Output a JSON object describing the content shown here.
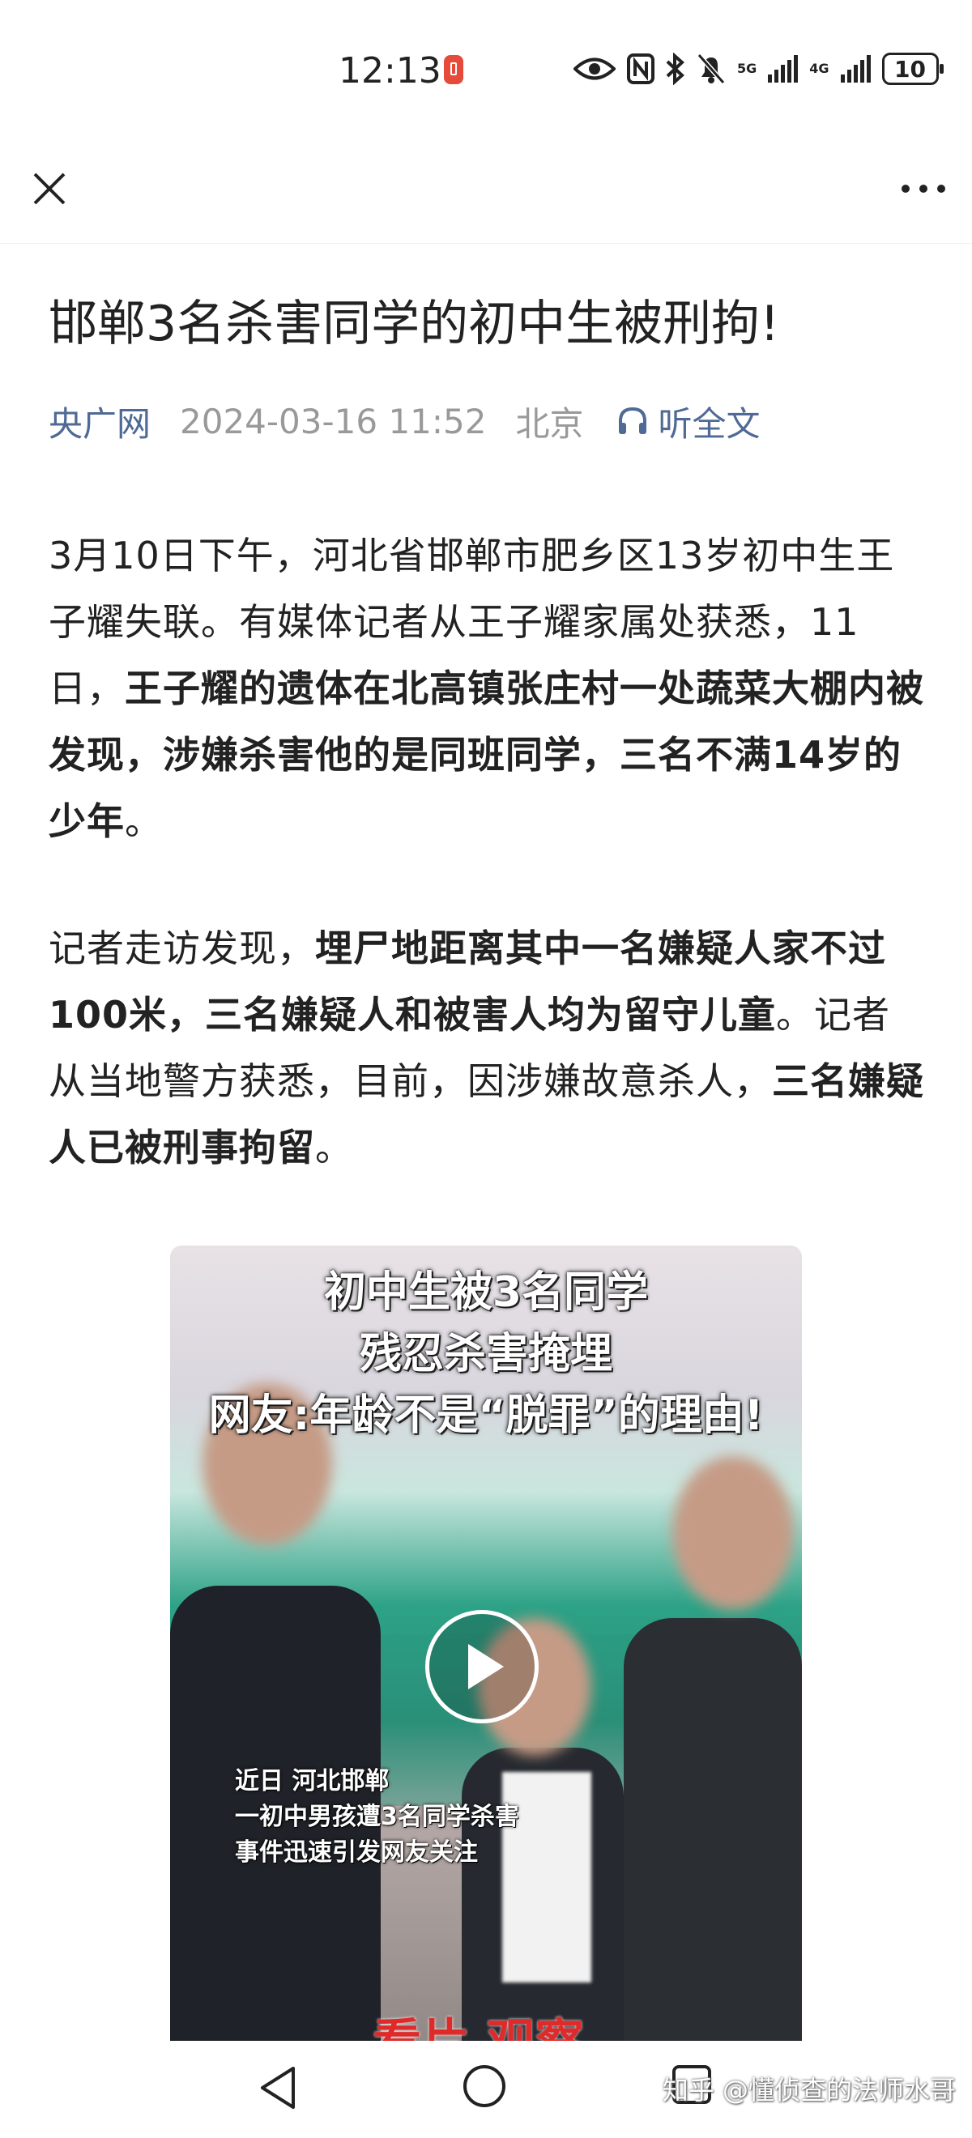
{
  "status_bar": {
    "time": "12:13",
    "network_1": "5G",
    "network_2": "4G",
    "battery": "10",
    "icons": [
      "eye-icon",
      "nfc-icon",
      "bluetooth-icon",
      "mute-bell-icon",
      "signal-icon",
      "battery-icon"
    ]
  },
  "app_bar": {
    "close_icon": "close-icon",
    "more_icon": "more-icon"
  },
  "article": {
    "title": "邯郸3名杀害同学的初中生被刑拘!",
    "source": "央广网",
    "date": "2024-03-16 11:52",
    "location": "北京",
    "listen_label": "听全文",
    "paragraph_1": {
      "normal": "3月10日下午，河北省邯郸市肥乡区13岁初中生王子耀失联。有媒体记者从王子耀家属处获悉，11日，",
      "bold": "王子耀的遗体在北高镇张庄村一处蔬菜大棚内被发现，涉嫌杀害他的是同班同学，三名不满14岁的少年",
      "end": "。"
    },
    "paragraph_2": {
      "normal_1": "记者走访发现，",
      "bold_1": "埋尸地距离其中一名嫌疑人家不过100米，三名嫌疑人和被害人均为留守儿童",
      "normal_2": "。记者从当地警方获悉，目前，因涉嫌故意杀人，",
      "bold_2": "三名嫌疑人已被刑事拘留",
      "end": "。"
    }
  },
  "video": {
    "caption_line_1": "初中生被3名同学",
    "caption_line_2": "残忍杀害掩埋",
    "caption_line_3": "网友:年龄不是“脱罪”的理由!",
    "subtitle_line_1": "近日  河北邯郸",
    "subtitle_line_2": "一初中男孩遭3名同学杀害",
    "subtitle_line_3": "事件迅速引发网友关注",
    "logo_text": "看片 观察"
  },
  "watermark": "知乎 @懂侦查的法师水哥"
}
